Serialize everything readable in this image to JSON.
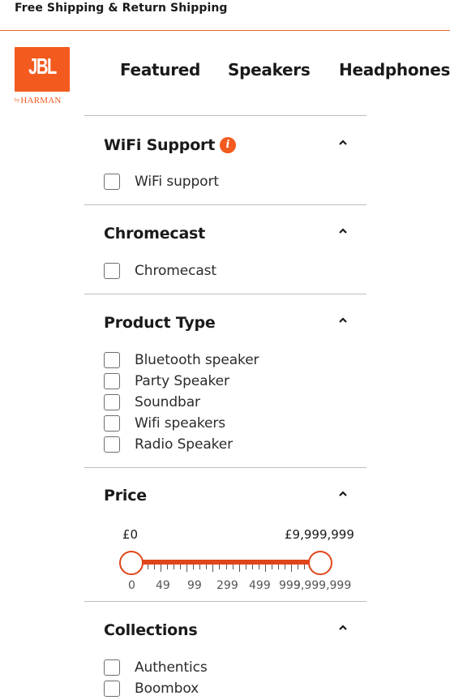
{
  "promo_bar": {
    "text": "Free Shipping & Return Shipping"
  },
  "logo": {
    "brand": "JBL",
    "sub_prefix": "by",
    "sub": "HARMAN",
    "color": "#f25a1e"
  },
  "nav": {
    "items": [
      "Featured",
      "Speakers",
      "Headphones"
    ]
  },
  "filters": {
    "wifi": {
      "title": "WiFi Support",
      "info_icon": "i",
      "options": [
        "WiFi support"
      ]
    },
    "chromecast": {
      "title": "Chromecast",
      "options": [
        "Chromecast"
      ]
    },
    "product_type": {
      "title": "Product Type",
      "options": [
        "Bluetooth speaker",
        "Party Speaker",
        "Soundbar",
        "Wifi speakers",
        "Radio Speaker"
      ]
    },
    "price": {
      "title": "Price",
      "min_label": "£0",
      "max_label": "£9,999,999",
      "tick_labels": [
        "0",
        "49",
        "99",
        "299",
        "499",
        "999",
        "9,999,999"
      ]
    },
    "collections": {
      "title": "Collections",
      "options": [
        "Authentics",
        "Boombox"
      ]
    }
  },
  "colors": {
    "accent": "#f25a1e",
    "divider": "#bdbdbd"
  }
}
